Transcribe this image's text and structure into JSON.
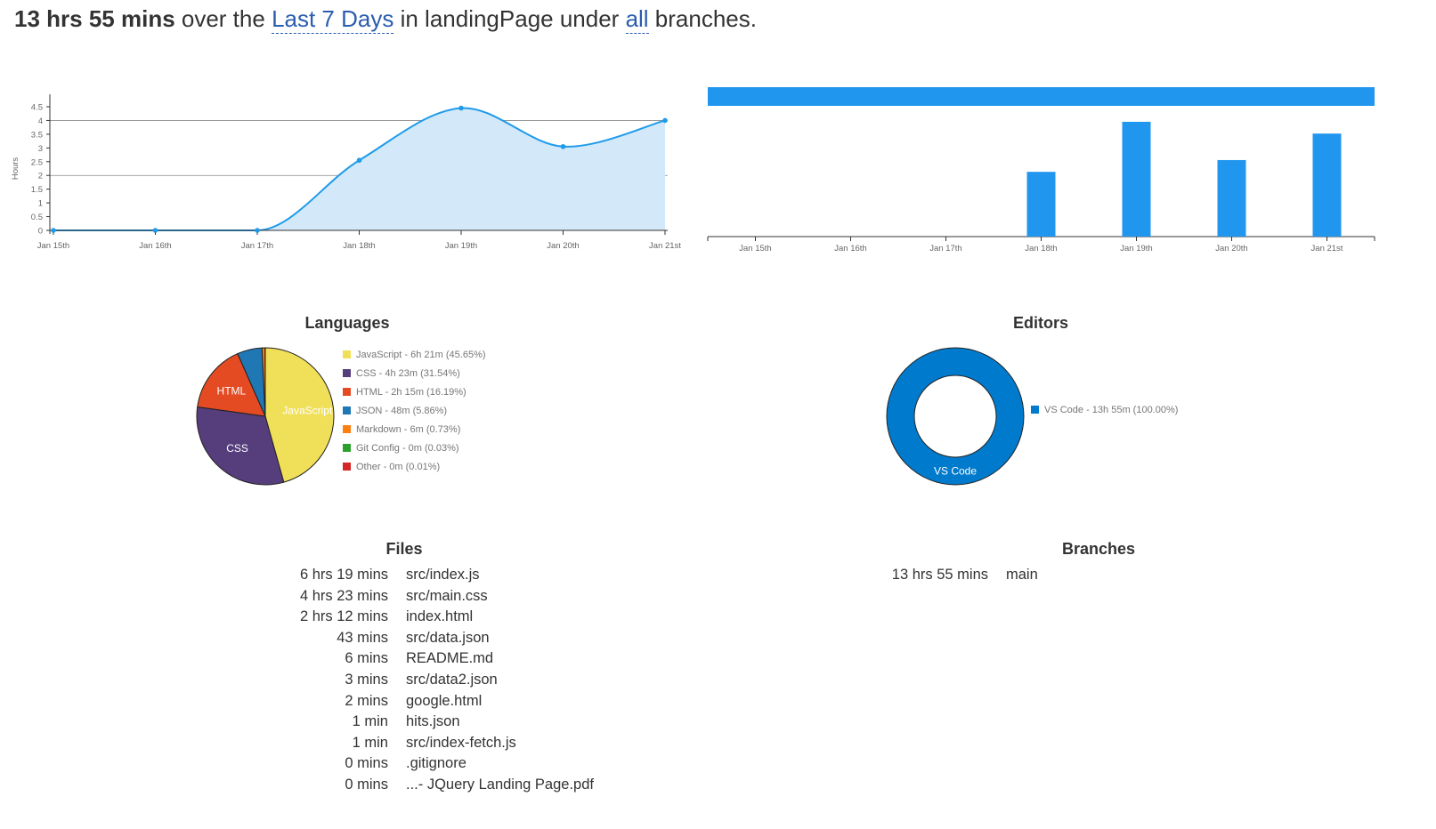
{
  "summary": {
    "total": "13 hrs 55 mins",
    "text_over": " over the ",
    "range": "Last 7 Days",
    "text_in": " in landingPage under ",
    "branch_filter": "all",
    "text_end": " branches."
  },
  "chart_data": [
    {
      "type": "area",
      "ylabel": "Hours",
      "categories": [
        "Jan 15th",
        "Jan 16th",
        "Jan 17th",
        "Jan 18th",
        "Jan 19th",
        "Jan 20th",
        "Jan 21st"
      ],
      "values": [
        0,
        0,
        0,
        2.55,
        4.45,
        3.05,
        4.0
      ],
      "yticks": [
        "0",
        "0.5",
        "1",
        "1.5",
        "2",
        "2.5",
        "3",
        "3.5",
        "4",
        "4.5"
      ],
      "ylim": [
        0,
        4.5
      ],
      "gridlines": [
        2,
        4
      ],
      "color": "#1f9bea",
      "fill": "#d3e9f9"
    },
    {
      "type": "bar",
      "categories": [
        "Jan 15th",
        "Jan 16th",
        "Jan 17th",
        "Jan 18th",
        "Jan 19th",
        "Jan 20th",
        "Jan 21st"
      ],
      "values": [
        0,
        0,
        0,
        2.2,
        3.9,
        2.6,
        3.5
      ],
      "ylim": [
        0,
        4.2
      ],
      "color": "#2196ee"
    },
    {
      "type": "pie",
      "title": "Languages",
      "slices": [
        {
          "label": "JavaScript",
          "legend": "JavaScript - 6h 21m (45.65%)",
          "value": 45.65,
          "color": "#f0e059"
        },
        {
          "label": "CSS",
          "legend": "CSS - 4h 23m (31.54%)",
          "value": 31.54,
          "color": "#563d7c"
        },
        {
          "label": "HTML",
          "legend": "HTML - 2h 15m (16.19%)",
          "value": 16.19,
          "color": "#e44b23"
        },
        {
          "label": "",
          "legend": "JSON - 48m (5.86%)",
          "value": 5.86,
          "color": "#1f77b4"
        },
        {
          "label": "",
          "legend": "Markdown - 6m (0.73%)",
          "value": 0.73,
          "color": "#ff7f0e"
        },
        {
          "label": "",
          "legend": "Git Config - 0m (0.03%)",
          "value": 0.03,
          "color": "#2ca02c"
        },
        {
          "label": "",
          "legend": "Other - 0m (0.01%)",
          "value": 0.01,
          "color": "#d62728"
        }
      ]
    },
    {
      "type": "pie",
      "title": "Editors",
      "donut": true,
      "slices": [
        {
          "label": "VS Code",
          "legend": "VS Code - 13h 55m (100.00%)",
          "value": 100,
          "color": "#007acc"
        }
      ]
    }
  ],
  "languages": {
    "title": "Languages",
    "legend": [
      {
        "label": "JavaScript - 6h 21m (45.65%)",
        "color": "#f0e059"
      },
      {
        "label": "CSS - 4h 23m (31.54%)",
        "color": "#563d7c"
      },
      {
        "label": "HTML - 2h 15m (16.19%)",
        "color": "#e44b23"
      },
      {
        "label": "JSON - 48m (5.86%)",
        "color": "#1f77b4"
      },
      {
        "label": "Markdown - 6m (0.73%)",
        "color": "#ff7f0e"
      },
      {
        "label": "Git Config - 0m (0.03%)",
        "color": "#2ca02c"
      },
      {
        "label": "Other - 0m (0.01%)",
        "color": "#d62728"
      }
    ]
  },
  "editors": {
    "title": "Editors",
    "legend": [
      {
        "label": "VS Code - 13h 55m (100.00%)",
        "color": "#007acc"
      }
    ]
  },
  "files": {
    "title": "Files",
    "rows": [
      {
        "duration": "6 hrs 19 mins",
        "name": "src/index.js"
      },
      {
        "duration": "4 hrs 23 mins",
        "name": "src/main.css"
      },
      {
        "duration": "2 hrs 12 mins",
        "name": "index.html"
      },
      {
        "duration": "43 mins",
        "name": "src/data.json"
      },
      {
        "duration": "6 mins",
        "name": "README.md"
      },
      {
        "duration": "3 mins",
        "name": "src/data2.json"
      },
      {
        "duration": "2 mins",
        "name": "google.html"
      },
      {
        "duration": "1 min",
        "name": "hits.json"
      },
      {
        "duration": "1 min",
        "name": "src/index-fetch.js"
      },
      {
        "duration": "0 mins",
        "name": ".gitignore"
      },
      {
        "duration": "0 mins",
        "name": "...- JQuery Landing Page.pdf"
      }
    ]
  },
  "branches": {
    "title": "Branches",
    "rows": [
      {
        "duration": "13 hrs 55 mins",
        "name": "main"
      }
    ]
  }
}
